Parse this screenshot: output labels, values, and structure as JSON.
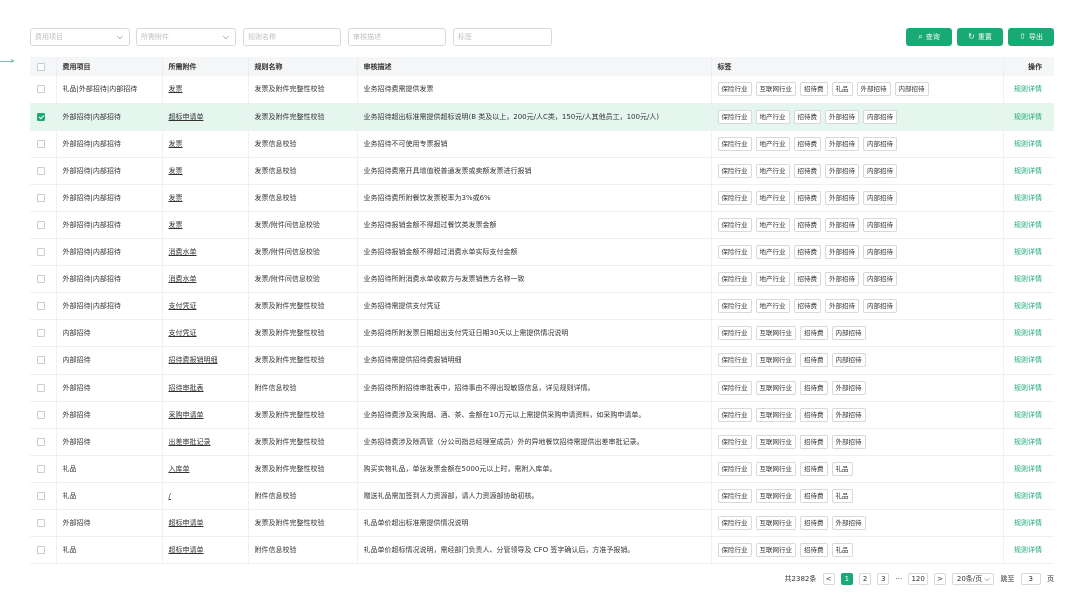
{
  "filters": {
    "cost_item_placeholder": "费用项目",
    "attachment_placeholder": "所需附件",
    "rule_name_placeholder": "规则名称",
    "review_desc_placeholder": "审核描述",
    "tag_placeholder": "标签"
  },
  "buttons": {
    "query": "查询",
    "reset": "重置",
    "export": "导出"
  },
  "columns": [
    "费用项目",
    "所需附件",
    "规则名称",
    "审核描述",
    "标签",
    "操作"
  ],
  "rows": [
    {
      "selected": false,
      "cost_item": "礼品|外部招待|内部招待",
      "attachment": "发票",
      "rule_name": "发票及附件完整性校验",
      "review_desc": "业务招待费需提供发票",
      "tags": [
        "保险行业",
        "互联网行业",
        "招待费",
        "礼品",
        "外部招待",
        "内部招待"
      ],
      "action": "规则详情"
    },
    {
      "selected": true,
      "cost_item": "外部招待|内部招待",
      "attachment": "超标申请单",
      "rule_name": "发票及附件完整性校验",
      "review_desc": "业务招待超出标准需提供超标说明(B 类及以上，200元/人C类，150元/人其他员工，100元/人)",
      "tags": [
        "保险行业",
        "地产行业",
        "招待费",
        "外部招待",
        "内部招待"
      ],
      "action": "规则详情"
    },
    {
      "selected": false,
      "cost_item": "外部招待|内部招待",
      "attachment": "发票",
      "rule_name": "发票信息校验",
      "review_desc": "业务招待不可使用专票报销",
      "tags": [
        "保险行业",
        "地产行业",
        "招待费",
        "外部招待",
        "内部招待"
      ],
      "action": "规则详情"
    },
    {
      "selected": false,
      "cost_item": "外部招待|内部招待",
      "attachment": "发票",
      "rule_name": "发票信息校验",
      "review_desc": "业务招待费需开具增值税普通发票或卖额发票进行报销",
      "tags": [
        "保险行业",
        "地产行业",
        "招待费",
        "外部招待",
        "内部招待"
      ],
      "action": "规则详情"
    },
    {
      "selected": false,
      "cost_item": "外部招待|内部招待",
      "attachment": "发票",
      "rule_name": "发票信息校验",
      "review_desc": "业务招待费所附餐饮发票税率为3%或6%",
      "tags": [
        "保险行业",
        "地产行业",
        "招待费",
        "外部招待",
        "内部招待"
      ],
      "action": "规则详情"
    },
    {
      "selected": false,
      "cost_item": "外部招待|内部招待",
      "attachment": "发票",
      "rule_name": "发票/附件间信息校验",
      "review_desc": "业务招待报销金额不得超过餐饮类发票金额",
      "tags": [
        "保险行业",
        "地产行业",
        "招待费",
        "外部招待",
        "内部招待"
      ],
      "action": "规则详情"
    },
    {
      "selected": false,
      "cost_item": "外部招待|内部招待",
      "attachment": "消费水单",
      "rule_name": "发票/附件间信息校验",
      "review_desc": "业务招待报销金额不得超过消费水单实际支付金额",
      "tags": [
        "保险行业",
        "地产行业",
        "招待费",
        "外部招待",
        "内部招待"
      ],
      "action": "规则详情"
    },
    {
      "selected": false,
      "cost_item": "外部招待|内部招待",
      "attachment": "消费水单",
      "rule_name": "发票/附件间信息校验",
      "review_desc": "业务招待所附消费水单收款方与发票销售方名称一致",
      "tags": [
        "保险行业",
        "地产行业",
        "招待费",
        "外部招待",
        "内部招待"
      ],
      "action": "规则详情"
    },
    {
      "selected": false,
      "cost_item": "外部招待|内部招待",
      "attachment": "支付凭证",
      "rule_name": "发票及附件完整性校验",
      "review_desc": "业务招待需提供支付凭证",
      "tags": [
        "保险行业",
        "地产行业",
        "招待费",
        "外部招待",
        "内部招待"
      ],
      "action": "规则详情"
    },
    {
      "selected": false,
      "cost_item": "内部招待",
      "attachment": "支付凭证",
      "rule_name": "发票及附件完整性校验",
      "review_desc": "业务招待所附发票日期超出支付凭证日期30天以上需提供情况说明",
      "tags": [
        "保险行业",
        "互联网行业",
        "招待费",
        "内部招待"
      ],
      "action": "规则详情"
    },
    {
      "selected": false,
      "cost_item": "内部招待",
      "attachment": "招待费报销明细",
      "rule_name": "发票及附件完整性校验",
      "review_desc": "业务招待需提供招待费报销明细",
      "tags": [
        "保险行业",
        "互联网行业",
        "招待费",
        "内部招待"
      ],
      "action": "规则详情"
    },
    {
      "selected": false,
      "cost_item": "外部招待",
      "attachment": "招待审批表",
      "rule_name": "附件信息校验",
      "review_desc": "业务招待所附招待审批表中，招待事由不得出现敏感信息，详见规则详情。",
      "tags": [
        "保险行业",
        "互联网行业",
        "招待费",
        "外部招待"
      ],
      "action": "规则详情"
    },
    {
      "selected": false,
      "cost_item": "外部招待",
      "attachment": "采购申请单",
      "rule_name": "发票及附件完整性校验",
      "review_desc": "业务招待费涉及采购烟、酒、茶、金额在10万元以上需提供采购申请资料，如采购申请单。",
      "tags": [
        "保险行业",
        "互联网行业",
        "招待费",
        "外部招待"
      ],
      "action": "规则详情"
    },
    {
      "selected": false,
      "cost_item": "外部招待",
      "attachment": "出差审批记录",
      "rule_name": "发票及附件完整性校验",
      "review_desc": "业务招待费涉及除高管（分公司指总经理室成员）外的异地餐饮招待需提供出差审批记录。",
      "tags": [
        "保险行业",
        "互联网行业",
        "招待费",
        "外部招待"
      ],
      "action": "规则详情"
    },
    {
      "selected": false,
      "cost_item": "礼品",
      "attachment": "入库单",
      "rule_name": "发票及附件完整性校验",
      "review_desc": "购买实物礼品，单张发票金额在5000元以上时，需附入库单。",
      "tags": [
        "保险行业",
        "互联网行业",
        "招待费",
        "礼品"
      ],
      "action": "规则详情"
    },
    {
      "selected": false,
      "cost_item": "礼品",
      "attachment": "/",
      "rule_name": "附件信息校验",
      "review_desc": "赠送礼品需加签到人力资源部，请人力资源部协助初核。",
      "tags": [
        "保险行业",
        "互联网行业",
        "招待费",
        "礼品"
      ],
      "action": "规则详情"
    },
    {
      "selected": false,
      "cost_item": "外部招待",
      "attachment": "超标申请单",
      "rule_name": "发票及附件完整性校验",
      "review_desc": "礼品单价超出标准需提供情况说明",
      "tags": [
        "保险行业",
        "互联网行业",
        "招待费",
        "外部招待"
      ],
      "action": "规则详情"
    },
    {
      "selected": false,
      "cost_item": "礼品",
      "attachment": "超标申请单",
      "rule_name": "附件信息校验",
      "review_desc": "礼品单价超标情况说明，需经部门负责人、分管领导及 CFO 签字确认后，方准予报销。",
      "tags": [
        "保险行业",
        "互联网行业",
        "招待费",
        "礼品"
      ],
      "action": "规则详情"
    }
  ],
  "pagination": {
    "total": "共2382条",
    "prev": "<",
    "pages": [
      "1",
      "2",
      "3",
      "···",
      "120"
    ],
    "next": ">",
    "page_size": "20条/页",
    "jump_label": "跳至",
    "jump_value": "3",
    "page_unit": "页"
  }
}
